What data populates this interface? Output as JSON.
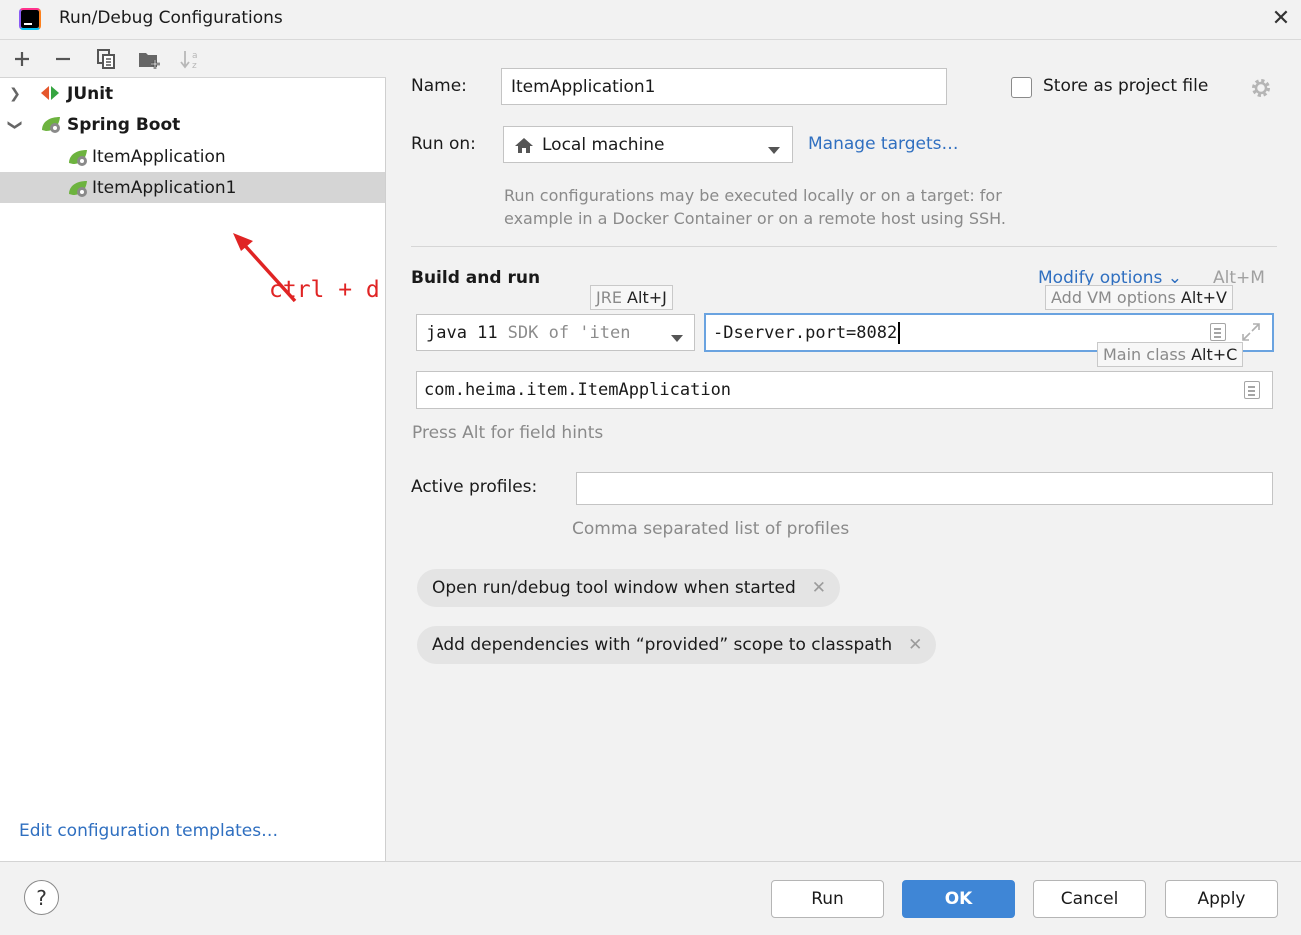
{
  "window": {
    "title": "Run/Debug Configurations",
    "app_icon": "intellij-icon",
    "close_icon": "close-icon"
  },
  "sidebar": {
    "toolbar": [
      "add-icon",
      "remove-icon",
      "copy-icon",
      "new-folder-icon",
      "sort-icon"
    ],
    "tree": [
      {
        "label": "JUnit",
        "icon": "junit-icon",
        "expanded": false
      },
      {
        "label": "Spring Boot",
        "icon": "spring-boot-icon",
        "expanded": true
      },
      {
        "label": "ItemApplication",
        "icon": "spring-boot-config-icon"
      },
      {
        "label": "ItemApplication1",
        "icon": "spring-boot-config-icon",
        "selected": true
      }
    ],
    "annotation": "ctrl + d",
    "edit_templates": "Edit configuration templates…"
  },
  "form": {
    "name_label": "Name:",
    "name_value": "ItemApplication1",
    "store_label": "Store as project file",
    "run_on_label": "Run on:",
    "run_on_value": "Local machine",
    "manage_targets": "Manage targets…",
    "run_on_hint_1": "Run configurations may be executed locally or on a target: for",
    "run_on_hint_2": "example in a Docker Container or on a remote host using SSH.",
    "build_run_label": "Build and run",
    "modify_options": "Modify options",
    "modify_shortcut": "Alt+M",
    "jre_tooltip": {
      "text": "JRE",
      "shortcut": "Alt+J"
    },
    "vm_tooltip": {
      "text": "Add VM options",
      "shortcut": "Alt+V"
    },
    "main_tooltip": {
      "text": "Main class",
      "shortcut": "Alt+C"
    },
    "jre_value": "java 11",
    "jre_suffix": "SDK of 'iten",
    "vm_options_value": "-Dserver.port=8082",
    "main_class_value": "com.heima.item.ItemApplication",
    "field_hint": "Press Alt for field hints",
    "profiles_label": "Active profiles:",
    "profiles_value": "",
    "profiles_hint": "Comma separated list of profiles",
    "chips": [
      "Open run/debug tool window when started",
      "Add dependencies with “provided” scope to classpath"
    ]
  },
  "footer": {
    "help": "?",
    "run": "Run",
    "ok": "OK",
    "cancel": "Cancel",
    "apply": "Apply"
  },
  "colors": {
    "accent": "#3f86d6",
    "link": "#2f6fc0",
    "annotation": "#e02424",
    "selection": "#d5d5d5"
  }
}
